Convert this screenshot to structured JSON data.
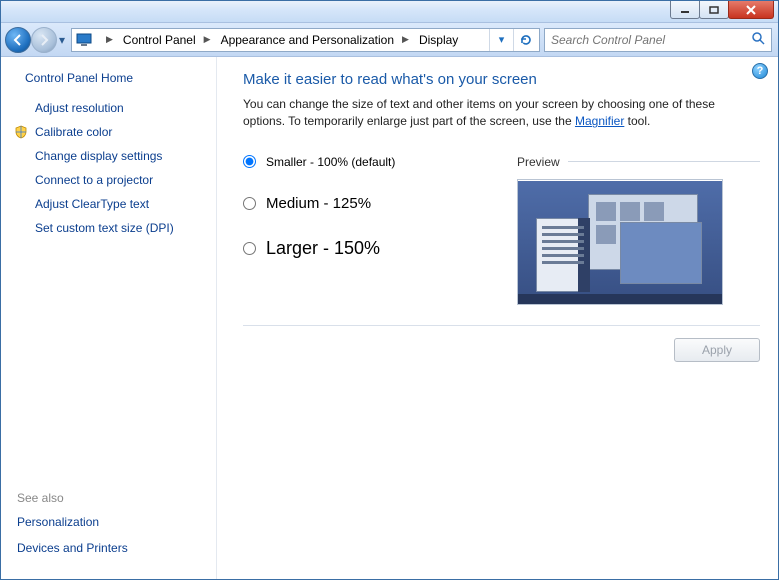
{
  "breadcrumb": {
    "items": [
      "Control Panel",
      "Appearance and Personalization",
      "Display"
    ]
  },
  "search": {
    "placeholder": "Search Control Panel"
  },
  "sidebar": {
    "home_label": "Control Panel Home",
    "links": [
      {
        "label": "Adjust resolution",
        "has_shield": false
      },
      {
        "label": "Calibrate color",
        "has_shield": true
      },
      {
        "label": "Change display settings",
        "has_shield": false
      },
      {
        "label": "Connect to a projector",
        "has_shield": false
      },
      {
        "label": "Adjust ClearType text",
        "has_shield": false
      },
      {
        "label": "Set custom text size (DPI)",
        "has_shield": false
      }
    ],
    "see_also_label": "See also",
    "see_also": [
      "Personalization",
      "Devices and Printers"
    ]
  },
  "main": {
    "heading": "Make it easier to read what's on your screen",
    "description_pre": "You can change the size of text and other items on your screen by choosing one of these options. To temporarily enlarge just part of the screen, use the ",
    "description_link": "Magnifier",
    "description_post": " tool.",
    "options": [
      {
        "label": "Smaller - 100% (default)",
        "selected": true,
        "size_class": "lab0"
      },
      {
        "label": "Medium - 125%",
        "selected": false,
        "size_class": "lab1"
      },
      {
        "label": "Larger - 150%",
        "selected": false,
        "size_class": "lab2"
      }
    ],
    "preview_label": "Preview",
    "apply_label": "Apply"
  },
  "window_controls": {
    "minimize": "Minimize",
    "maximize": "Maximize",
    "close": "Close"
  }
}
